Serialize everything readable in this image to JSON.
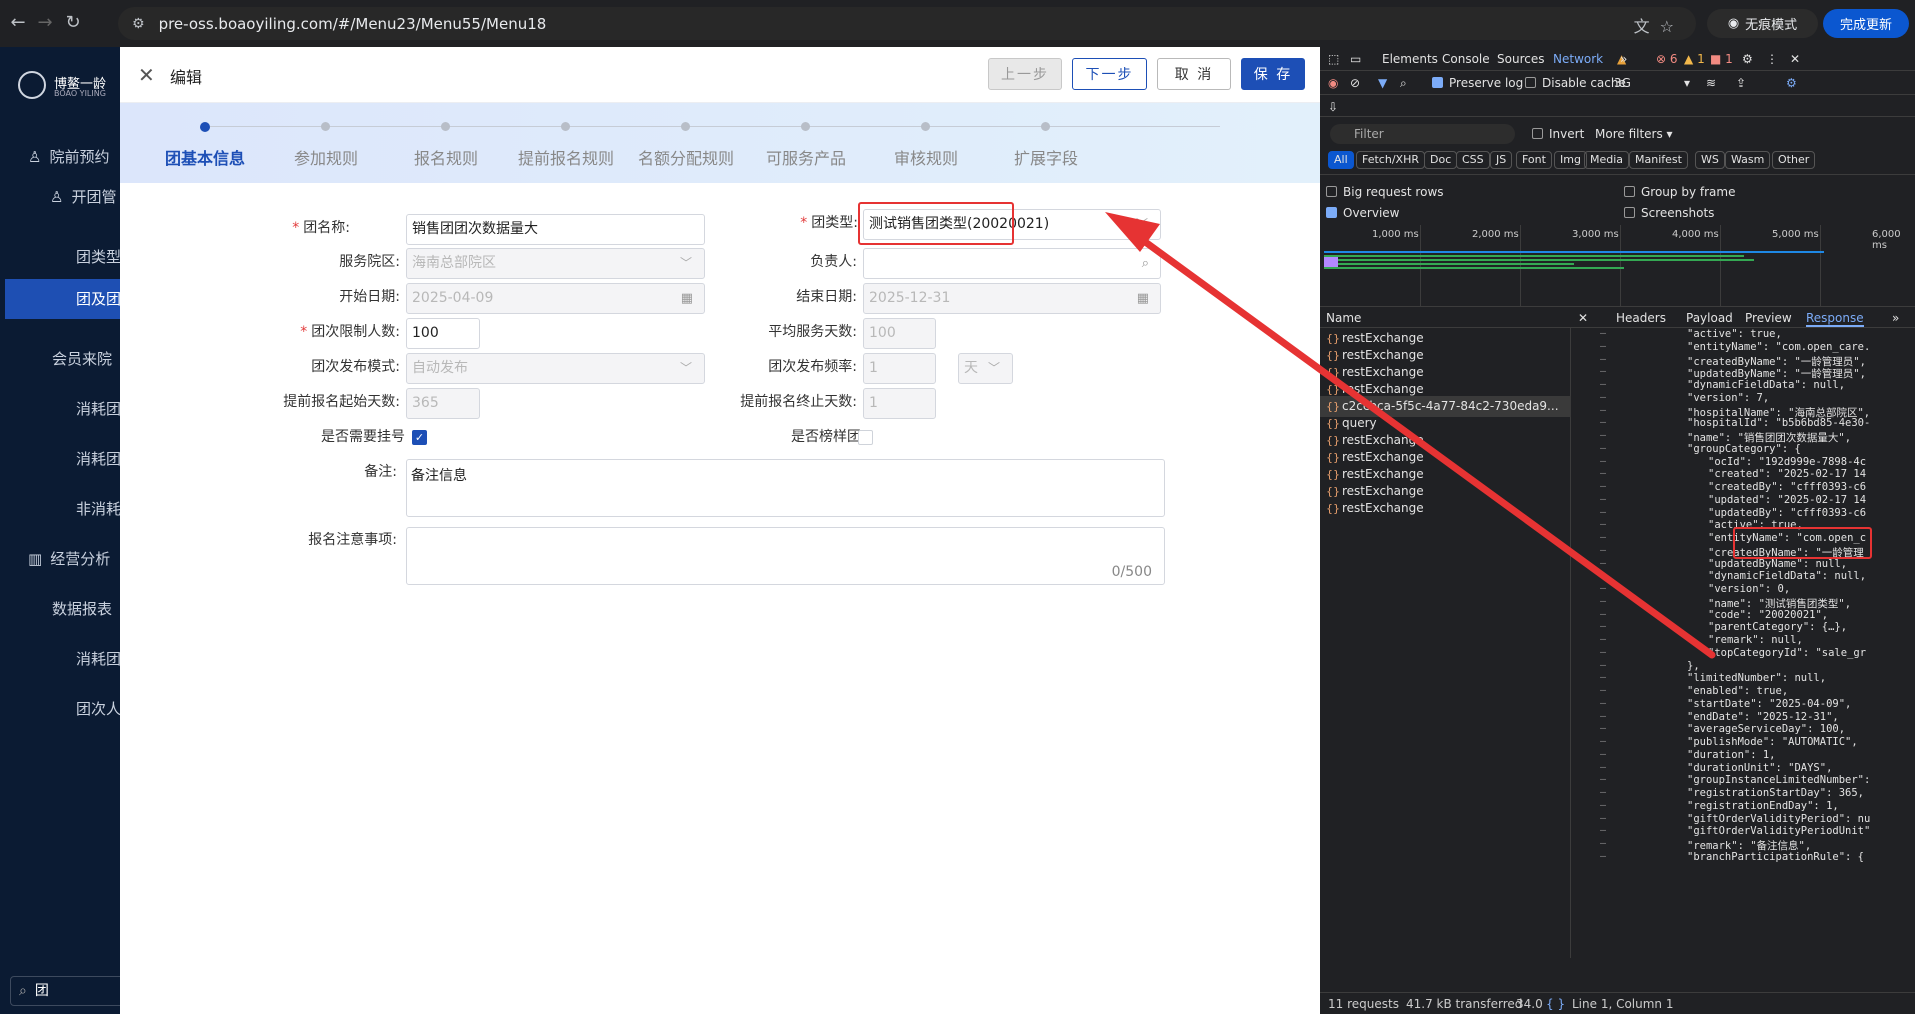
{
  "browser": {
    "url": "pre-oss.boaoyiling.com/#/Menu23/Menu55/Menu18",
    "incognito_label": "无痕模式",
    "update_label": "完成更新"
  },
  "sidebar": {
    "logo_cn": "博鳌一龄",
    "logo_en": "BOAO YILING",
    "items": [
      "院前预约",
      "开团管",
      "团类型",
      "团及团",
      "会员来院",
      "消耗团",
      "消耗团",
      "非消耗",
      "经营分析",
      "数据报表",
      "消耗团",
      "团次人"
    ],
    "search_value": "团"
  },
  "header": {
    "title": "编辑",
    "prev": "上一步",
    "next": "下一步",
    "cancel": "取 消",
    "save": "保 存"
  },
  "steps": [
    "团基本信息",
    "参加规则",
    "报名规则",
    "提前报名规则",
    "名额分配规则",
    "可服务产品",
    "审核规则",
    "扩展字段"
  ],
  "form": {
    "name_label": "团名称:",
    "name_value": "销售团团次数据量大",
    "type_label": "团类型:",
    "type_value": "测试销售团类型(20020021)",
    "campus_label": "服务院区:",
    "campus_value": "海南总部院区",
    "owner_label": "负责人:",
    "start_label": "开始日期:",
    "start_value": "2025-04-09",
    "end_label": "结束日期:",
    "end_value": "2025-12-31",
    "limit_label": "团次限制人数:",
    "limit_value": "100",
    "avg_label": "平均服务天数:",
    "avg_value": "100",
    "mode_label": "团次发布模式:",
    "mode_value": "自动发布",
    "freq_label": "团次发布频率:",
    "freq_value": "1",
    "freq_unit": "天",
    "adv_start_label": "提前报名起始天数:",
    "adv_start_value": "365",
    "adv_end_label": "提前报名终止天数:",
    "adv_end_value": "1",
    "reg_label": "是否需要挂号",
    "reg_checked": true,
    "sample_label": "是否榜样团",
    "sample_checked": false,
    "remark_label": "备注:",
    "remark_value": "备注信息",
    "notes_label": "报名注意事项:",
    "notes_count": "0/500"
  },
  "devtools": {
    "tabs": [
      "Elements",
      "Console",
      "Sources",
      "Network",
      "»"
    ],
    "errors": "6",
    "warnings": "1",
    "issues": "1",
    "preserve_log": "Preserve log",
    "disable_cache": "Disable cache",
    "throttle": "3G",
    "filter_placeholder": "Filter",
    "invert": "Invert",
    "more_filters": "More filters",
    "chips": [
      "All",
      "Fetch/XHR",
      "Doc",
      "CSS",
      "JS",
      "Font",
      "Img",
      "Media",
      "Manifest",
      "WS",
      "Wasm",
      "Other"
    ],
    "options": [
      "Big request rows",
      "Group by frame",
      "Overview",
      "Screenshots"
    ],
    "ticks": [
      "1,000 ms",
      "2,000 ms",
      "3,000 ms",
      "4,000 ms",
      "5,000 ms",
      "6,000 ms"
    ],
    "name_header": "Name",
    "detail_tabs": [
      "Headers",
      "Payload",
      "Preview",
      "Response",
      "»"
    ],
    "requests": [
      "restExchange",
      "restExchange",
      "restExchange",
      "restExchange",
      "c2ccbca-5f5c-4a77-84c2-730eda9...",
      "query",
      "restExchange",
      "restExchange",
      "restExchange",
      "restExchange",
      "restExchange"
    ],
    "response_lines": [
      "\"active\": true,",
      "\"entityName\": \"com.open_care.",
      "\"createdByName\": \"一龄管理员\",",
      "\"updatedByName\": \"一龄管理员\",",
      "\"dynamicFieldData\": null,",
      "\"version\": 7,",
      "\"hospitalName\": \"海南总部院区\",",
      "\"hospitalId\": \"b5b6bd85-4e30-",
      "\"name\": \"销售团团次数据量大\",",
      "\"groupCategory\": {",
      "  \"ocId\": \"192d999e-7898-4c",
      "  \"created\": \"2025-02-17 14",
      "  \"createdBy\": \"cfff0393-c6",
      "  \"updated\": \"2025-02-17 14",
      "  \"updatedBy\": \"cfff0393-c6",
      "  \"active\": true,",
      "  \"entityName\": \"com.open_c",
      "  \"createdByName\": \"一龄管理",
      "  \"updatedByName\": null,",
      "  \"dynamicFieldData\": null,",
      "  \"version\": 0,",
      "  \"name\": \"测试销售团类型\",",
      "  \"code\": \"20020021\",",
      "  \"parentCategory\": {…},",
      "  \"remark\": null,",
      "  \"topCategoryId\": \"sale_gr",
      "},",
      "\"limitedNumber\": null,",
      "\"enabled\": true,",
      "\"startDate\": \"2025-04-09\",",
      "\"endDate\": \"2025-12-31\",",
      "\"averageServiceDay\": 100,",
      "\"publishMode\": \"AUTOMATIC\",",
      "\"duration\": 1,",
      "\"durationUnit\": \"DAYS\",",
      "\"groupInstanceLimitedNumber\":",
      "\"registrationStartDay\": 365,",
      "\"registrationEndDay\": 1,",
      "\"giftOrderValidityPeriod\": nu",
      "\"giftOrderValidityPeriodUnit\"",
      "\"remark\": \"备注信息\",",
      "\"branchParticipationRule\": {"
    ],
    "status_requests": "11 requests",
    "status_transferred": "41.7 kB transferred",
    "status_size": "34.0",
    "status_pos": "Line 1, Column 1"
  },
  "colors": {
    "primary": "#1d4fb6",
    "highlight": "#e63333",
    "sidebar_bg": "#0b1b33"
  }
}
